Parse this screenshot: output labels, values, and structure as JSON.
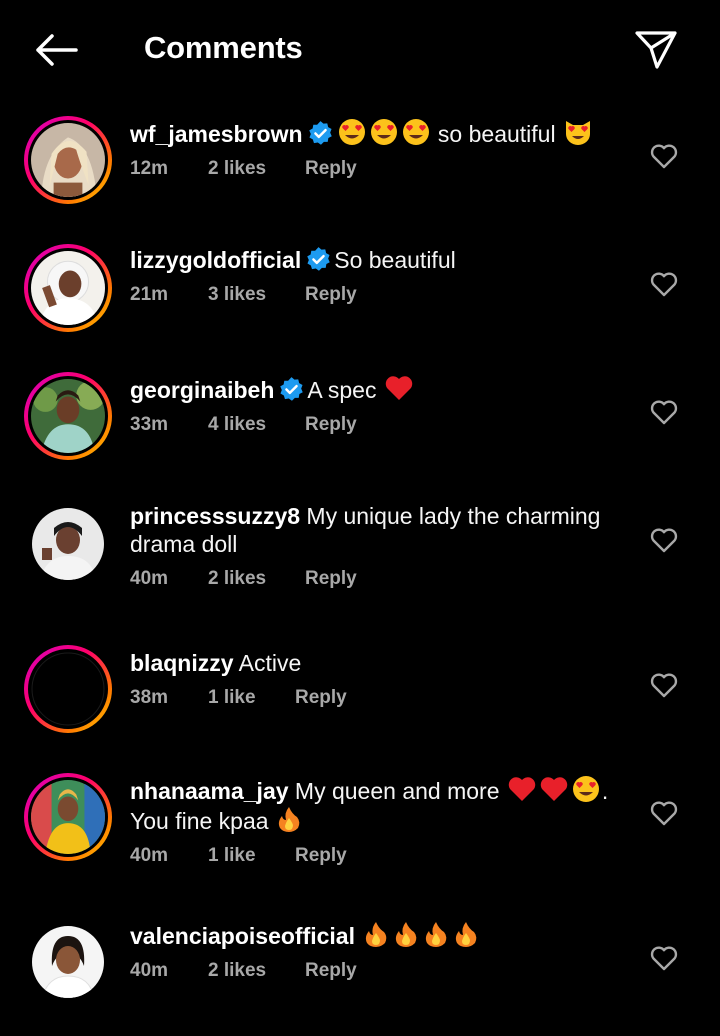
{
  "header": {
    "title": "Comments",
    "back_icon": "back-arrow-icon",
    "share_icon": "send-icon"
  },
  "colors": {
    "background": "#000000",
    "text": "#ffffff",
    "meta": "#a8a8a8",
    "verified": "#1d9bf0",
    "heart": "#e8202a"
  },
  "comments": [
    {
      "username": "wf_jamesbrown",
      "verified": true,
      "text": " so beautiful ",
      "emojis_before": [
        "heart-eyes-emoji",
        "heart-eyes-emoji",
        "heart-eyes-emoji"
      ],
      "emojis_after": [
        "heart-eyes-cat-emoji"
      ],
      "time": "12m",
      "likes": "2 likes",
      "reply": "Reply",
      "story_ring": true
    },
    {
      "username": "lizzygoldofficial",
      "verified": true,
      "text": "So beautiful",
      "time": "21m",
      "likes": "3 likes",
      "reply": "Reply",
      "story_ring": true
    },
    {
      "username": "georginaibeh",
      "verified": true,
      "text": "A spec ",
      "emojis_after": [
        "red-heart-emoji"
      ],
      "time": "33m",
      "likes": "4 likes",
      "reply": "Reply",
      "story_ring": true
    },
    {
      "username": "princesssuzzy8",
      "verified": false,
      "text": "My unique lady the charming drama doll",
      "time": "40m",
      "likes": "2 likes",
      "reply": "Reply",
      "story_ring": false
    },
    {
      "username": "blaqnizzy",
      "verified": false,
      "text": "Active",
      "time": "38m",
      "likes": "1 like",
      "reply": "Reply",
      "story_ring": true
    },
    {
      "username": "nhanaama_jay",
      "verified": false,
      "text": "My queen and more ",
      "text2": ". You fine kpaa ",
      "time": "40m",
      "likes": "1 like",
      "reply": "Reply",
      "story_ring": true
    },
    {
      "username": "valenciapoiseofficial",
      "verified": false,
      "text": " ",
      "time": "40m",
      "likes": "2 likes",
      "reply": "Reply",
      "story_ring": false
    }
  ]
}
